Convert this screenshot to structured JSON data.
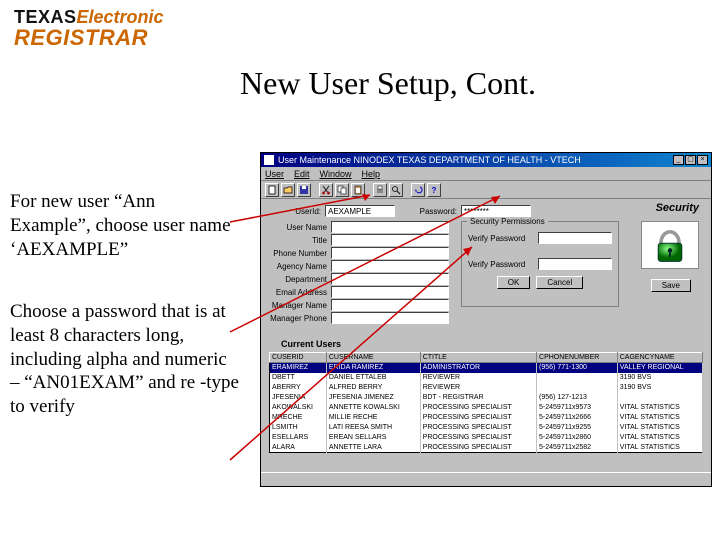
{
  "logo": {
    "texas": "TEXAS",
    "electronic": "Electronic",
    "registrar": "REGISTRAR"
  },
  "slide_title": "New User Setup, Cont.",
  "para1": "For new user “Ann Example”, choose user name ‘AEXAMPLE”",
  "para2": "Choose a password that is at least 8 characters long, including alpha and numeric – “AN01EXAM” and re -type to verify",
  "window": {
    "title": "User Maintenance  NINODEX  TEXAS DEPARTMENT OF HEALTH - VTECH",
    "menu": {
      "user": "User",
      "edit": "Edit",
      "window": "Window",
      "help": "Help"
    },
    "security_label": "Security",
    "fields": {
      "userid_label": "UserId:",
      "userid_value": "AEXAMPLE",
      "password_label": "Password:",
      "password_value": "********",
      "user_name_label": "User Name",
      "title_label": "Title",
      "phone_label": "Phone Number",
      "agency_label": "Agency Name",
      "dept_label": "Department",
      "email_label": "Email Address",
      "mgr_name_label": "Manager Name",
      "mgr_phone_label": "Manager Phone"
    },
    "permissions": {
      "title": "Security Permissions",
      "verify1_label": "Verify Password",
      "verify2_label": "Verify Password",
      "ok": "OK",
      "cancel": "Cancel"
    },
    "save_label": "Save",
    "current_users_label": "Current Users",
    "grid": {
      "headers": [
        "CUSERID",
        "CUSERNAME",
        "CTITLE",
        "CPHONENUMBER",
        "CAGENCYNAME"
      ],
      "rows": [
        [
          "ERAMIREZ",
          "ERIDA RAMIREZ",
          "ADMINISTRATOR",
          "(956) 771-1300",
          "VALLEY REGIONAL"
        ],
        [
          "DBETT",
          "DANIEL ETTALEB",
          "REVIEWER",
          "",
          "3190 BVS"
        ],
        [
          "ABERRY",
          "ALFRED BERRY",
          "REVIEWER",
          "",
          "3190 BVS"
        ],
        [
          "JFESENIA",
          "JFESENIA JIMENEZ",
          "BDT - REGISTRAR",
          "(956) 127-1213",
          ""
        ],
        [
          "AKOWALSKI",
          "ANNETTE KOWALSKI",
          "PROCESSING SPECIALIST",
          "5-2459711x9573",
          "VITAL STATISTICS"
        ],
        [
          "MRECHE",
          "MILLIE RECHE",
          "PROCESSING SPECIALIST",
          "5-2459711x2666",
          "VITAL STATISTICS"
        ],
        [
          "LSMITH",
          "LATI REESA SMITH",
          "PROCESSING SPECIALIST",
          "5-2459711x9255",
          "VITAL STATISTICS"
        ],
        [
          "ESELLARS",
          "EREAN SELLARS",
          "PROCESSING SPECIALIST",
          "5-2459711x2860",
          "VITAL STATISTICS"
        ],
        [
          "ALARA",
          "ANNETTE LARA",
          "PROCESSING SPECIALIST",
          "5-2459711x2582",
          "VITAL STATISTICS"
        ]
      ]
    }
  }
}
